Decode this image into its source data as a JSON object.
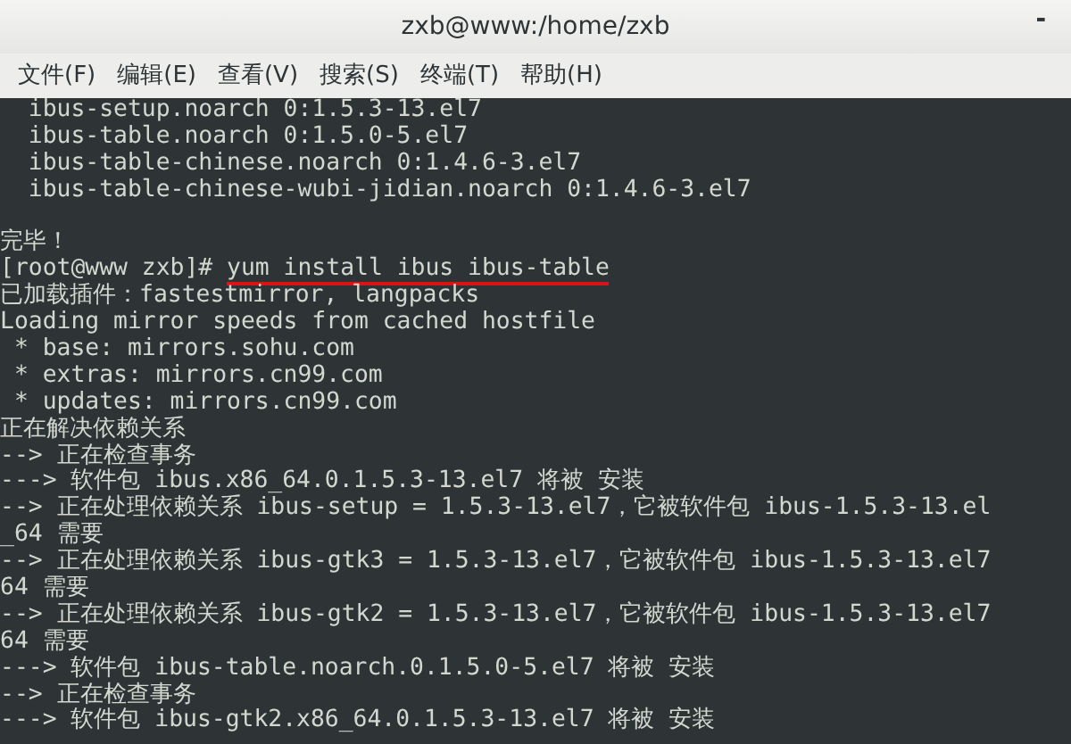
{
  "window": {
    "title": "zxb@www:/home/zxb",
    "minimize_glyph": "-"
  },
  "menu": [
    "文件(F)",
    "编辑(E)",
    "查看(V)",
    "搜索(S)",
    "终端(T)",
    "帮助(H)"
  ],
  "terminal": {
    "lines": [
      {
        "kind": "output",
        "text": "  ibus-setup.noarch 0:1.5.3-13.el7"
      },
      {
        "kind": "output",
        "text": "  ibus-table.noarch 0:1.5.0-5.el7"
      },
      {
        "kind": "output",
        "text": "  ibus-table-chinese.noarch 0:1.4.6-3.el7"
      },
      {
        "kind": "output",
        "text": "  ibus-table-chinese-wubi-jidian.noarch 0:1.4.6-3.el7"
      },
      {
        "kind": "blank"
      },
      {
        "kind": "output",
        "text": "完毕！"
      },
      {
        "kind": "command",
        "prompt": "[root@www zxb]#",
        "command": "yum install ibus ibus-table",
        "underlined": true
      },
      {
        "kind": "output",
        "text": "已加载插件：fastestmirror, langpacks"
      },
      {
        "kind": "output",
        "text": "Loading mirror speeds from cached hostfile"
      },
      {
        "kind": "output",
        "text": " * base: mirrors.sohu.com"
      },
      {
        "kind": "output",
        "text": " * extras: mirrors.cn99.com"
      },
      {
        "kind": "output",
        "text": " * updates: mirrors.cn99.com"
      },
      {
        "kind": "output",
        "text": "正在解决依赖关系"
      },
      {
        "kind": "output",
        "text": "--> 正在检查事务"
      },
      {
        "kind": "output",
        "text": "---> 软件包 ibus.x86_64.0.1.5.3-13.el7 将被 安装"
      },
      {
        "kind": "output",
        "text": "--> 正在处理依赖关系 ibus-setup = 1.5.3-13.el7，它被软件包 ibus-1.5.3-13.el"
      },
      {
        "kind": "output",
        "text": "_64 需要"
      },
      {
        "kind": "output",
        "text": "--> 正在处理依赖关系 ibus-gtk3 = 1.5.3-13.el7，它被软件包 ibus-1.5.3-13.el7"
      },
      {
        "kind": "output",
        "text": "64 需要"
      },
      {
        "kind": "output",
        "text": "--> 正在处理依赖关系 ibus-gtk2 = 1.5.3-13.el7，它被软件包 ibus-1.5.3-13.el7"
      },
      {
        "kind": "output",
        "text": "64 需要"
      },
      {
        "kind": "output",
        "text": "---> 软件包 ibus-table.noarch.0.1.5.0-5.el7 将被 安装"
      },
      {
        "kind": "output",
        "text": "--> 正在检查事务"
      },
      {
        "kind": "output",
        "text": "---> 软件包 ibus-gtk2.x86_64.0.1.5.3-13.el7 将被 安装"
      }
    ]
  }
}
